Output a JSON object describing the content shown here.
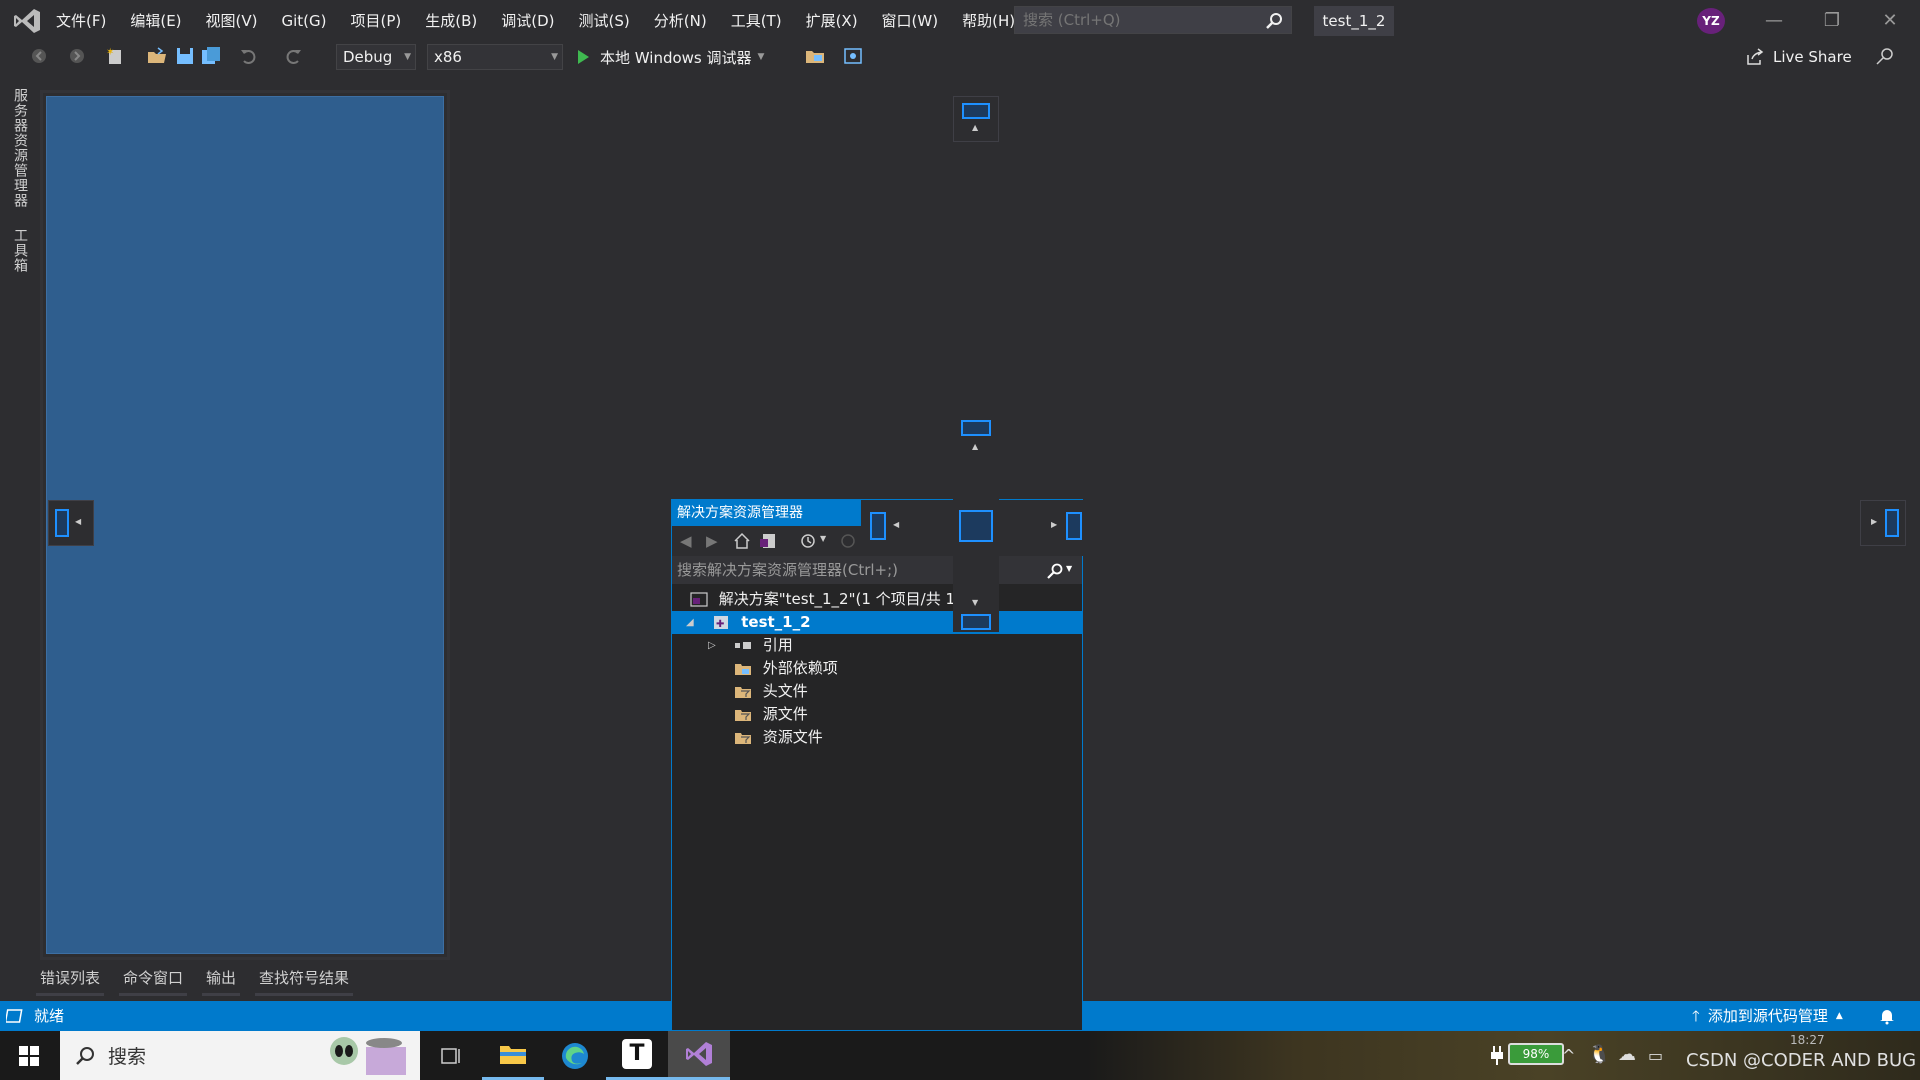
{
  "titlebar": {
    "menu": [
      "文件(F)",
      "编辑(E)",
      "视图(V)",
      "Git(G)",
      "项目(P)",
      "生成(B)",
      "调试(D)",
      "测试(S)",
      "分析(N)",
      "工具(T)",
      "扩展(X)",
      "窗口(W)",
      "帮助(H)"
    ],
    "search_placeholder": "搜索 (Ctrl+Q)",
    "project_name": "test_1_2",
    "avatar_initials": "YZ"
  },
  "toolbar": {
    "config": "Debug",
    "platform": "x86",
    "run_label": "本地 Windows 调试器",
    "live_share": "Live Share"
  },
  "left_tabs": [
    "服务器资源管理器",
    "工具箱"
  ],
  "bottom_tabs": [
    "错误列表",
    "命令窗口",
    "输出",
    "查找符号结果"
  ],
  "statusbar": {
    "status": "就绪",
    "source_control": "添加到源代码管理"
  },
  "solution_explorer": {
    "title": "解决方案资源管理器",
    "search_placeholder": "搜索解决方案资源管理器(Ctrl+;)",
    "solution_label": "解决方案\"test_1_2\"(1 个项目/共 1 个)",
    "project_label": "test_1_2",
    "items": [
      "引用",
      "外部依赖项",
      "头文件",
      "源文件",
      "资源文件"
    ]
  },
  "taskbar": {
    "search_label": "搜索",
    "battery": "98%",
    "watermark": "CSDN @CODER AND BUG",
    "clock": "18:27"
  },
  "colors": {
    "accent": "#007acc",
    "background": "#2d2d30",
    "dock_preview": "#2f5e8e",
    "vs_purple": "#68217a"
  }
}
